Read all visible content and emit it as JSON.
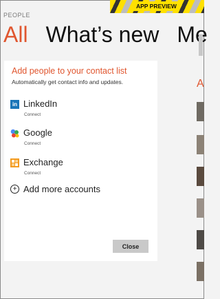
{
  "app_title": "PEOPLE",
  "banner_label": "APP PREVIEW",
  "pivots": [
    "All",
    "What’s new",
    "Me"
  ],
  "card": {
    "title": "Add people to your contact list",
    "subtitle": "Automatically get contact info and updates.",
    "accounts": [
      {
        "name": "LinkedIn",
        "action": "Connect",
        "icon": "linkedin-icon"
      },
      {
        "name": "Google",
        "action": "Connect",
        "icon": "google-icon"
      },
      {
        "name": "Exchange",
        "action": "Connect",
        "icon": "exchange-icon"
      }
    ],
    "add_more_label": "Add more accounts",
    "close_label": "Close"
  },
  "right_column_letter": "A",
  "colors": {
    "accent": "#e0562f",
    "linkedin": "#1a75b8",
    "banner_yellow": "#ffe000"
  }
}
